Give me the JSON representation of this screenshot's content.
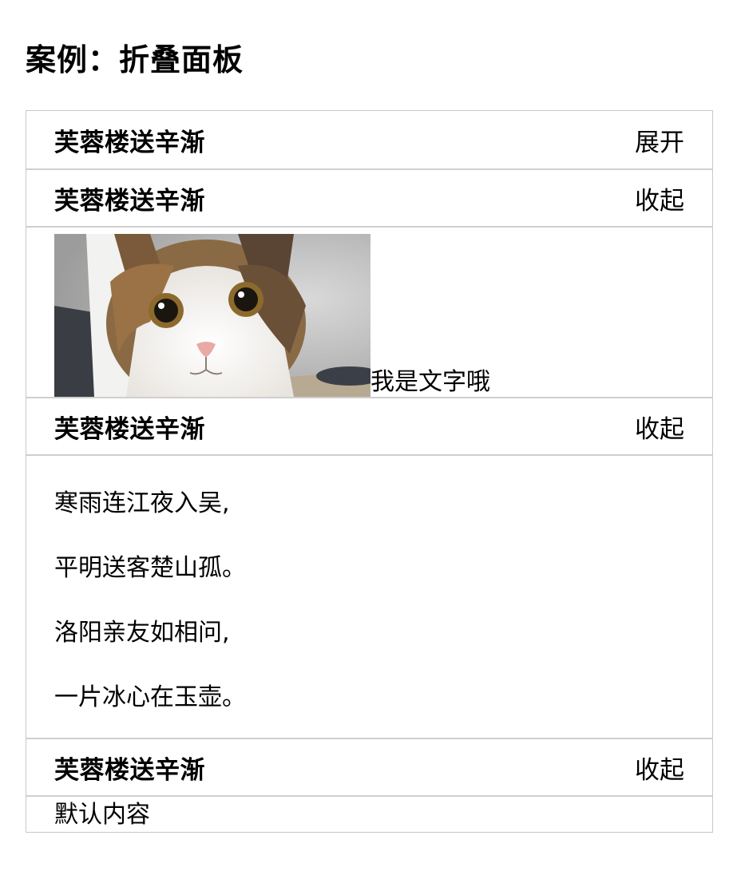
{
  "page": {
    "title": "案例：折叠面板"
  },
  "panels": [
    {
      "title": "芙蓉楼送辛渐",
      "toggle": "展开"
    },
    {
      "title": "芙蓉楼送辛渐",
      "toggle": "收起",
      "body": {
        "caption": "我是文字哦"
      }
    },
    {
      "title": "芙蓉楼送辛渐",
      "toggle": "收起",
      "body": {
        "lines": [
          "寒雨连江夜入吴,",
          "平明送客楚山孤。",
          "洛阳亲友如相问,",
          "一片冰心在玉壶。"
        ]
      }
    },
    {
      "title": "芙蓉楼送辛渐",
      "toggle": "收起",
      "body": {
        "text": "默认内容"
      }
    }
  ]
}
